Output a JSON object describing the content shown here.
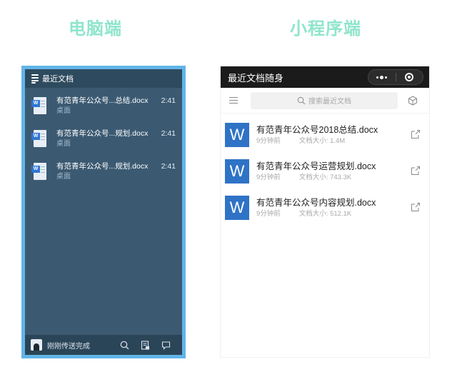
{
  "headings": {
    "pc": "电脑端",
    "mini": "小程序端"
  },
  "pc": {
    "title": "最近文档",
    "items": [
      {
        "name": "有范青年公众号...总结.docx",
        "location": "桌面",
        "time": "2:41",
        "badge": "W"
      },
      {
        "name": "有范青年公众号...规划.docx",
        "location": "桌面",
        "time": "2:41",
        "badge": "W"
      },
      {
        "name": "有范青年公众号...规划.docx",
        "location": "桌面",
        "time": "2:41",
        "badge": "W"
      }
    ],
    "footer": {
      "status": "刚刚传送完成"
    }
  },
  "mini": {
    "title": "最近文档随身",
    "search_placeholder": "搜索最近文档",
    "items": [
      {
        "name": "有范青年公众号2018总结.docx",
        "time": "9分钟前",
        "size": "文档大小: 1.4M",
        "badge": "W"
      },
      {
        "name": "有范青年公众号运营规划.docx",
        "time": "9分钟前",
        "size": "文档大小: 743.3K",
        "badge": "W"
      },
      {
        "name": "有范青年公众号内容规划.docx",
        "time": "9分钟前",
        "size": "文档大小: 512.1K",
        "badge": "W"
      }
    ]
  },
  "colors": {
    "heading": "#8fe5cc",
    "pc_frame": "#62b4e8",
    "pc_bg": "#3b5a72",
    "word_blue": "#2f73c6"
  }
}
